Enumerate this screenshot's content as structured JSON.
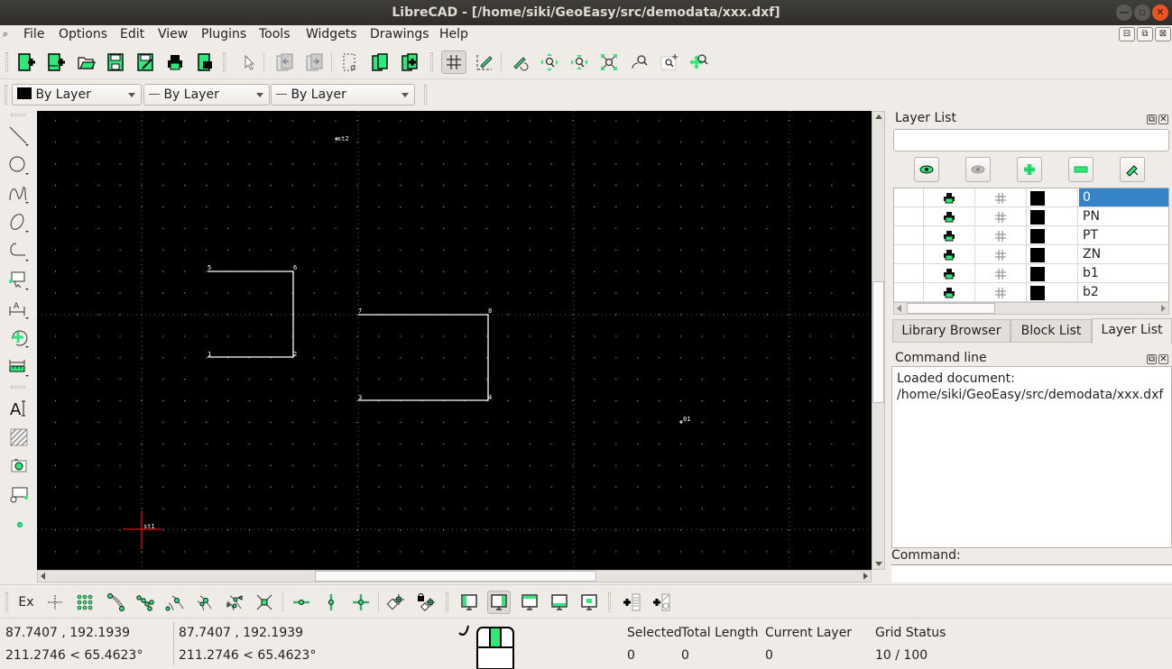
{
  "window": {
    "title": "LibreCAD - [/home/siki/GeoEasy/src/demodata/xxx.dxf]",
    "controls": [
      "minimize",
      "maximize",
      "close"
    ]
  },
  "menu": {
    "items": [
      "File",
      "Options",
      "Edit",
      "View",
      "Plugins",
      "Tools",
      "Widgets",
      "Drawings",
      "Help"
    ]
  },
  "toolbar_main": {
    "buttons": [
      "new-file",
      "new-from-template",
      "open-file",
      "save",
      "save-as",
      "print",
      "print-preview",
      "select-pointer",
      "undo",
      "redo",
      "cut-copy-clipboard",
      "block-insert",
      "block-add",
      "grid-toggle",
      "draft-mode",
      "redraw",
      "zoom-in",
      "zoom-out",
      "zoom-auto",
      "zoom-previous",
      "zoom-window",
      "zoom-pan"
    ],
    "active": "grid-toggle"
  },
  "pen_toolbar": {
    "color": {
      "value": "By Layer",
      "swatch": "#000000"
    },
    "line_type": {
      "value": "By Layer"
    },
    "line_width": {
      "value": "By Layer"
    }
  },
  "left_tools": [
    "line",
    "circle",
    "spline",
    "ellipse",
    "polyline",
    "select",
    "dimension",
    "modify",
    "measure",
    "text",
    "hatch",
    "image",
    "block",
    "point"
  ],
  "drawing": {
    "labels": {
      "p5": "5",
      "p6": "6",
      "p1": "1",
      "p2": "2",
      "p7": "7",
      "p8": "8",
      "p3": "3",
      "p4": "4",
      "st2": "st2",
      "st1": "st1",
      "p01": "01"
    },
    "background": "#000000",
    "line_color": "#ffffff",
    "crosshair_color": "#e01010"
  },
  "layer_list": {
    "title": "Layer List",
    "filter_value": "",
    "action_buttons": [
      "show-all-layers",
      "hide-all-layers",
      "add-layer",
      "remove-layer",
      "edit-layer"
    ],
    "layers": [
      {
        "name": "0",
        "selected": true,
        "color": "#000000"
      },
      {
        "name": "PN",
        "selected": false,
        "color": "#000000"
      },
      {
        "name": "PT",
        "selected": false,
        "color": "#000000"
      },
      {
        "name": "ZN",
        "selected": false,
        "color": "#000000"
      },
      {
        "name": "b1",
        "selected": false,
        "color": "#000000"
      },
      {
        "name": "b2",
        "selected": false,
        "color": "#000000"
      }
    ]
  },
  "dock_tabs": [
    "Library Browser",
    "Block List",
    "Layer List"
  ],
  "active_dock_tab": "Layer List",
  "command_line": {
    "title": "Command line",
    "output": "Loaded document: /home/siki/GeoEasy/src/demodata/xxx.dxf",
    "input_label": "Command:",
    "input_value": ""
  },
  "snap_toolbar": {
    "exclusive_label": "Ex",
    "buttons": [
      "snap-free",
      "snap-grid",
      "snap-endpoints",
      "snap-on-entity",
      "snap-center",
      "snap-middle",
      "snap-distance",
      "snap-intersection",
      "restrict-horizontal",
      "restrict-vertical",
      "restrict-orthogonal",
      "relative-zero",
      "lock-relative-zero",
      "view-left",
      "view-default",
      "view-top",
      "view-bottom",
      "view-center",
      "add-layer-list",
      "add-block"
    ],
    "active": "view-default"
  },
  "status": {
    "abs_coord": "87.7407 , 192.1939",
    "abs_polar": "211.2746 < 65.4623°",
    "rel_coord": "87.7407 , 192.1939",
    "rel_polar": "211.2746 < 65.4623°",
    "selected_label": "Selected",
    "selected_value": "0",
    "total_length_label": "Total Length",
    "total_length_value": "0",
    "current_layer_label": "Current Layer",
    "current_layer_value": "0",
    "grid_status_label": "Grid Status",
    "grid_status_value": "10 / 100"
  },
  "colors": {
    "accent_green": "#2ee87a",
    "selection_blue": "#3584c8",
    "close_orange": "#e9541f"
  }
}
